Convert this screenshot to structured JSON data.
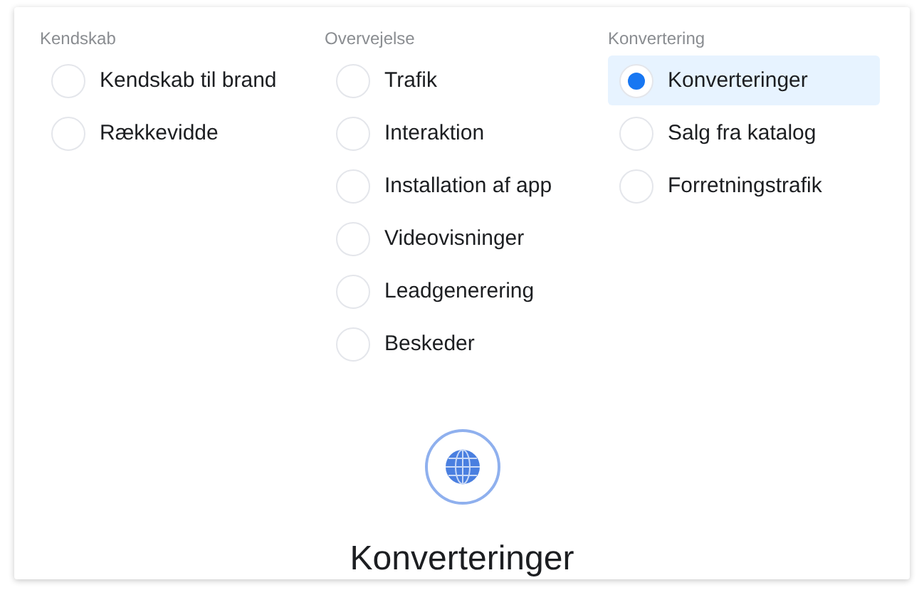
{
  "groups": [
    {
      "heading": "Kendskab",
      "options": [
        {
          "label": "Kendskab til brand",
          "selected": false
        },
        {
          "label": "Rækkevidde",
          "selected": false
        }
      ]
    },
    {
      "heading": "Overvejelse",
      "options": [
        {
          "label": "Trafik",
          "selected": false
        },
        {
          "label": "Interaktion",
          "selected": false
        },
        {
          "label": "Installation af app",
          "selected": false
        },
        {
          "label": "Videovisninger",
          "selected": false
        },
        {
          "label": "Leadgenerering",
          "selected": false
        },
        {
          "label": "Beskeder",
          "selected": false
        }
      ]
    },
    {
      "heading": "Konvertering",
      "options": [
        {
          "label": "Konverteringer",
          "selected": true
        },
        {
          "label": "Salg fra katalog",
          "selected": false
        },
        {
          "label": "Forretningstrafik",
          "selected": false
        }
      ]
    }
  ],
  "detail": {
    "title": "Konverteringer"
  }
}
